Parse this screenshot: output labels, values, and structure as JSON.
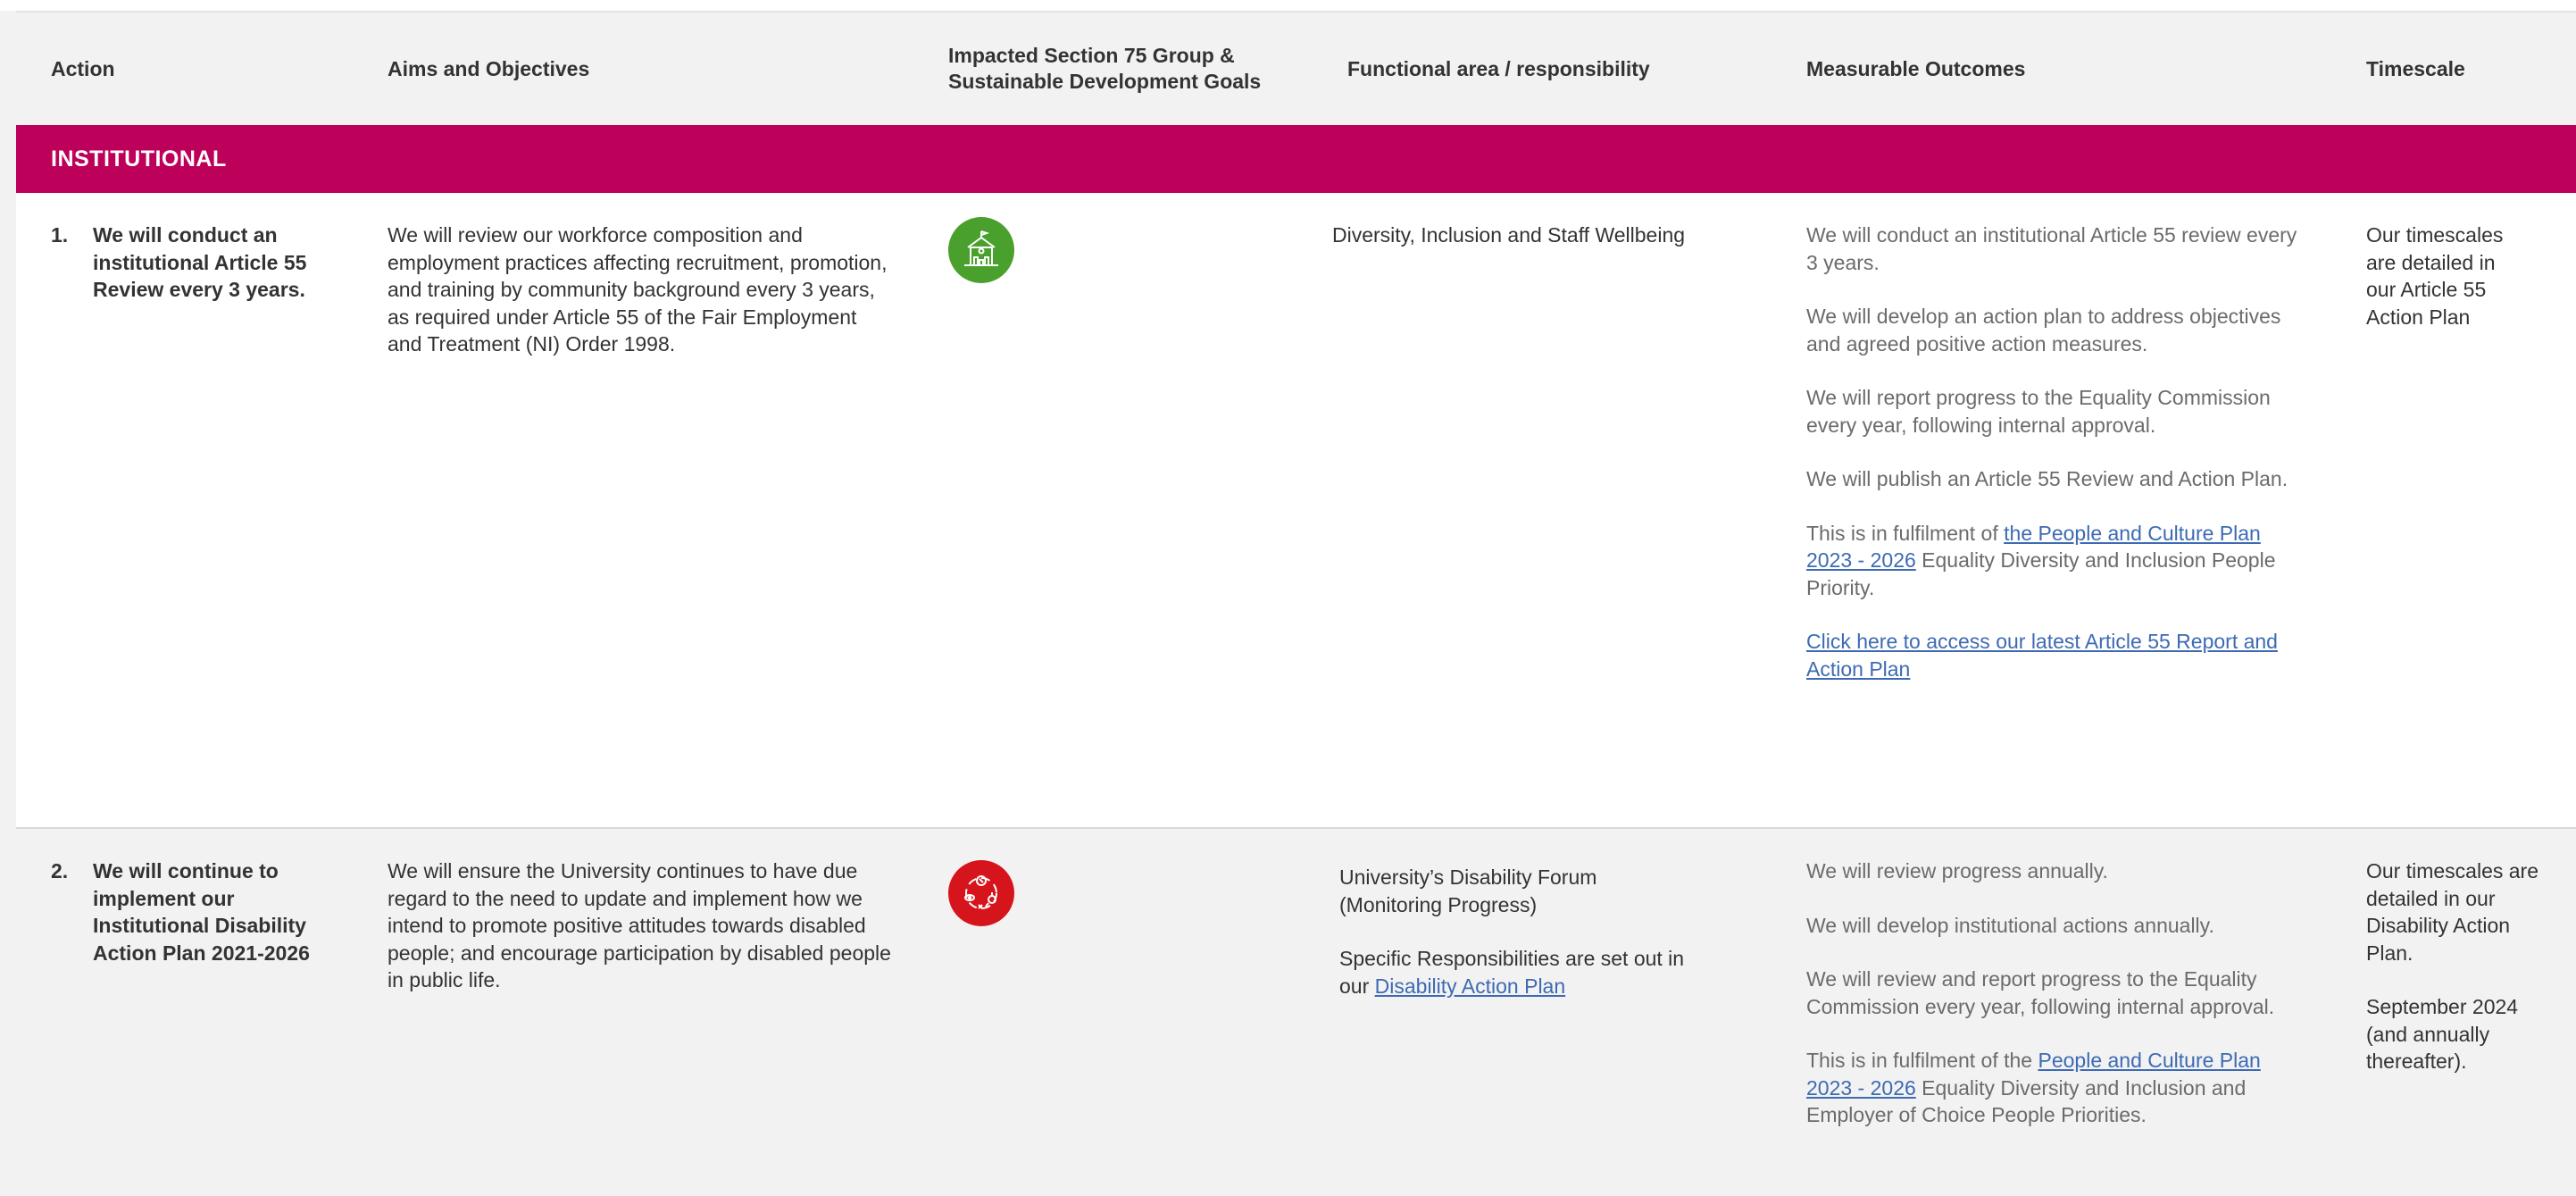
{
  "header": {
    "action": "Action",
    "aims": "Aims and Objectives",
    "impacted_line1": "Impacted Section 75 Group &",
    "impacted_line2": "Sustainable Development Goals",
    "functional": "Functional area / responsibility",
    "outcomes": "Measurable Outcomes",
    "timescale": "Timescale"
  },
  "section": {
    "title": "INSTITUTIONAL"
  },
  "colors": {
    "band": "#bd005a",
    "icon_green": "#4aa02c",
    "icon_red": "#d6141c",
    "link": "#3d6ab3"
  },
  "rows": [
    {
      "number": "1.",
      "action": "We will conduct an institutional Article 55 Review every 3 years.",
      "aims": "We will review our workforce composition and employment practices affecting recruitment, promotion, and training by community background every 3 years, as required under Article 55 of the Fair Employment and Treatment (NI) Order 1998.",
      "icon": "school-building-icon",
      "functional": "Diversity, Inclusion and Staff Wellbeing",
      "outcomes": [
        "We will conduct an institutional Article 55 review every 3 years.",
        "We will develop an action plan to address objectives and agreed positive action measures.",
        "We will report progress to the Equality Commission every year, following internal approval.",
        "We will publish an Article 55 Review and Action Plan."
      ],
      "fulfilment_prefix": "This is in fulfilment of ",
      "fulfilment_link": "the People and Culture Plan 2023 - 2026",
      "fulfilment_suffix": " Equality Diversity and Inclusion People Priority.",
      "report_link": "Click here to access our latest Article 55 Report and Action Plan",
      "timescale": "Our timescales are detailed in our Article 55 Action Plan"
    },
    {
      "number": "2.",
      "action": "We will continue to implement our Institutional Disability Action Plan 2021-2026",
      "aims": "We will ensure the University continues to have due regard to the need to update and implement how we intend to promote positive attitudes towards disabled people; and encourage participation by disabled people in public life.",
      "icon": "disability-symbols-icon",
      "functional_1": "University’s Disability Forum (Monitoring Progress)",
      "functional_2_prefix": "Specific Responsibilities are set out in our ",
      "functional_2_link": "Disability Action Plan",
      "outcomes": [
        "We will review progress annually.",
        "We will develop institutional actions annually.",
        "We will review and report progress to the Equality Commission every year, following internal approval."
      ],
      "fulfilment_prefix": "This is in fulfilment of the ",
      "fulfilment_link": "People and Culture Plan 2023 - 2026",
      "fulfilment_suffix": " Equality Diversity and Inclusion and Employer of Choice People Priorities.",
      "timescale_1": "Our timescales are detailed in our Disability Action Plan.",
      "timescale_2": "September 2024 (and annually thereafter)."
    }
  ]
}
